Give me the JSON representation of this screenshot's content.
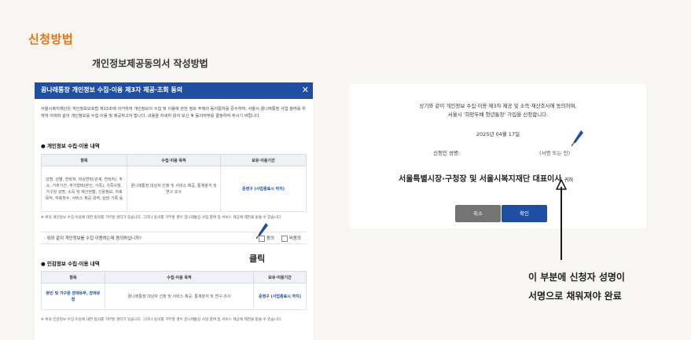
{
  "section_title": "신청방법",
  "document_title": "개인정보제공동의서 작성방법",
  "consent_form": {
    "header_title": "꿈나래통장 개인정보 수집·이용 제3자 제공·조회 동의",
    "close_symbol": "✕",
    "intro_text": "서울시복지재단은 개인정보보호법 제15조에 의거하여 개인정보의 수집 및 이용에 관한 정보 주체의 동의절차를 준수하여, 서울시 꿈나래통장 사업 참여를 위하여 아래와 같이 개인정보를 수집·이용 및 제공하고자 합니다. 내용을 자세히 읽어 보신 후 동의여부를 결정하여 주시기 바랍니다.",
    "section1": {
      "heading": "개인정보 수집·이용 내역",
      "columns": [
        "항목",
        "수집·이용 목적",
        "보유·이용기간"
      ],
      "row": {
        "items": "성명, 성별, 연락처, 비상연락(관계, 연락처), 주소, 거주기간, 주거형태(본인, 가족), 가족사항, 가구원 성명, 소득 및 재산현황, 신용정보, 저축목적, 저축횟수, 서비스 제공 내역, 상담 기록 등",
        "purpose": "꿈나래통장 대상자 선정 및 서비스 제공, 통계분석 및 연구·조사",
        "period": "준영구 (사업종료시 까지)"
      },
      "note": "※ 위의 개인정보 수집·이용에 대한 동의를 거부할 권리가 있습니다. 그러나 동의를 거부할 경우 꿈나래통장 사업 참여 및 서비스 제공에 제한을 받을 수 있습니다.",
      "agree_question": "· 위와 같이 개인정보를 수집·이용하는데 동의하십니까?",
      "agree_label": "동의",
      "disagree_label": "비동의"
    },
    "section2": {
      "heading": "민감정보 수집·이용 내역",
      "columns": [
        "항목",
        "수집·이용 목적",
        "보유·이용기간"
      ],
      "row": {
        "items": "본인 및 가구원 장애유무, 장애유형",
        "purpose": "꿈나래통장 대상자 선정 및 서비스 제공, 통계분석 및 연구·조사",
        "period": "준영구 (사업종료시 까지)"
      },
      "note": "※ 위의 민감정보 수집·이용에 대한 동의를 거부할 권리가 있습니다. 그러나 동의를 거부할 경우 꿈나래통장 사업 참여 및 서비스 제공에 제한을 받을 수 있습니다."
    },
    "click_annotation": "클릭"
  },
  "confirmation": {
    "line1": "상기와 같이 개인정보 수집·이용·제3자 제공 및 소득·재산조사에 동의하며,",
    "line2": "서울시 '희망두배 청년통장' 가입을 신청합니다.",
    "date": "2025년 04월 17일",
    "signer_label": "신청인 성명:",
    "signature_placeholder": "(서명 또는 인)",
    "recipient": "서울특별시장·구청장 및 서울시복지재단 대표이사",
    "recipient_suffix": "귀하",
    "cancel_label": "취소",
    "confirm_label": "확인"
  },
  "instruction": {
    "line1": "이 부분에 신청자 성명이",
    "line2": "서명으로 채워져야 완료"
  },
  "icons": {
    "pen": "pen-icon",
    "arrow": "arrow-up-icon"
  },
  "colors": {
    "accent_orange": "#e8720f",
    "primary_blue": "#1f4ea3",
    "cancel_gray": "#747474",
    "page_background": "#f7f6f2"
  }
}
